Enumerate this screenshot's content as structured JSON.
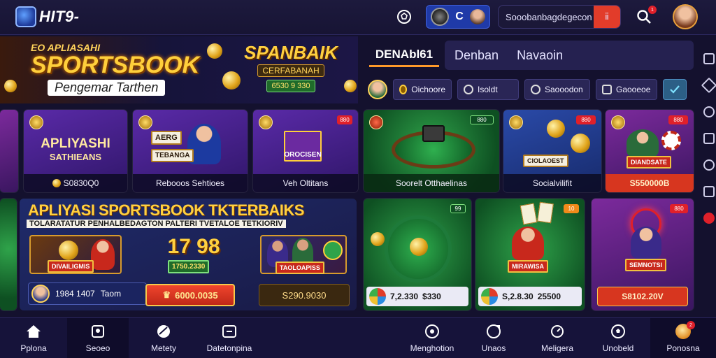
{
  "header": {
    "logo_text": "HIT9-",
    "wallet_letter": "C",
    "search_text": "Sooobanbagdegecon",
    "search_button": "ⅱ",
    "notification_badge": "1"
  },
  "hero": {
    "kicker": "EO APLIASAHI",
    "title": "SPORTSBOOK",
    "subtitle": "Pengemar Tarthen",
    "right_title": "SPANBAIK",
    "right_sub": "CERFABANAH",
    "right_chip": "6530 9 330"
  },
  "tabs": {
    "active": "DENAbl61",
    "items": [
      "Denban",
      "Navaoin"
    ]
  },
  "filters": [
    {
      "label": "Oichoore",
      "icon": "coin-icon"
    },
    {
      "label": "Isoldt",
      "icon": "ball-icon"
    },
    {
      "label": "Saooodon",
      "icon": "circle-icon"
    },
    {
      "label": "Gaooeoe",
      "icon": "shield-icon"
    }
  ],
  "cards_row1": [
    {
      "title": "APLIYASHI",
      "subtitle": "SATHIEANS",
      "bottom": "S0830Q0",
      "tag": ""
    },
    {
      "title": "AERG",
      "plate": "TEBANGA",
      "bottom": "Rebooos Sehtioes",
      "tag": ""
    },
    {
      "title": "",
      "plate": "OROCISEN",
      "bottom": "Veh Oltitans",
      "tag": "880"
    },
    {
      "title": "",
      "plate": "",
      "bottom": "Soorelt Otthaelinas",
      "tag": "880"
    },
    {
      "title": "",
      "plate": "CIOLAOEST",
      "bottom": "Socialvilifit",
      "tag": "880"
    },
    {
      "title": "",
      "plate": "DIANDSATE",
      "bottom": "S550000B",
      "tag": "880"
    }
  ],
  "promo": {
    "title": "APLIYASI SPORTSBOOK TKTERBAIKS",
    "subtitle": "TOLARATATUR PENHALBEDAGTON PALTERI TVETALOE TETKIORIV",
    "card_a_plate": "DIVAILIGMIS",
    "card_b_number": "17 98",
    "card_b_plate": "1750.2330",
    "card_c_plate": "TAOLOAPISS",
    "score_number": "1984 1407",
    "score_label": "Taom",
    "prize_amount": "6000.0035",
    "dark_amount": "S290.9030"
  },
  "cards_row2": [
    {
      "price_left": "7,2.330",
      "price_right": "$330",
      "tag": "99"
    },
    {
      "plate": "MIRAWISA",
      "price_left": "S,2.8.30",
      "price_right": "25500",
      "tag": "10"
    },
    {
      "plate": "SEMNOTSI",
      "bottom": "S8102.20V",
      "tag": "880"
    }
  ],
  "bottom_nav": [
    {
      "label": "Pplona",
      "icon": "home-icon"
    },
    {
      "label": "Seoeo",
      "icon": "ticket-icon"
    },
    {
      "label": "Metety",
      "icon": "ball-icon"
    },
    {
      "label": "Datetonpina",
      "icon": "card-icon"
    },
    {
      "label": "Menghotion",
      "icon": "clock-icon"
    },
    {
      "label": "Unaos",
      "icon": "chat-icon"
    },
    {
      "label": "Meligera",
      "icon": "search-icon"
    },
    {
      "label": "Unobeld",
      "icon": "soccer-icon"
    },
    {
      "label": "Ponosna",
      "icon": "gift-icon",
      "badge": "2"
    }
  ],
  "colors": {
    "accent": "#e23c2a",
    "gold": "#ffd040",
    "nav_bg": "#16133a"
  }
}
